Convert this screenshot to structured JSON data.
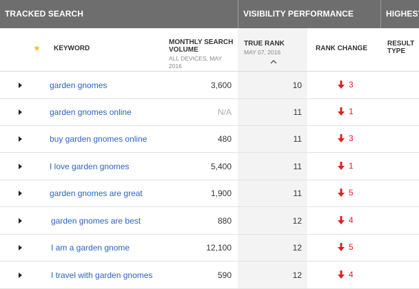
{
  "sections": {
    "tracked_search": "TRACKED SEARCH",
    "visibility_performance": "VISIBILITY PERFORMANCE",
    "highest": "HIGHEST"
  },
  "columns": {
    "keyword": "KEYWORD",
    "monthly_search_volume": "MONTHLY SEARCH VOLUME",
    "monthly_search_volume_sub": "ALL DEVICES, MAY 2016",
    "true_rank": "TRUE RANK",
    "true_rank_sub": "MAY 07, 2016",
    "rank_change": "RANK CHANGE",
    "result_type": "RESULT TYPE"
  },
  "icons": {
    "star": "star-icon",
    "sort": "chevron-up-icon",
    "expand": "caret-right-icon",
    "change": "arrow-down-icon"
  },
  "colors": {
    "header_bar": "#6e6e6e",
    "keyword_link": "#2c63c0",
    "rank_down": "#d9231f",
    "star": "#f0c020",
    "sorted_column": "#f3f3f3"
  },
  "rows": [
    {
      "keyword": "garden gnomes",
      "volume": "3,600",
      "rank": "10",
      "change": "3"
    },
    {
      "keyword": "garden gnomes online",
      "volume": "N/A",
      "rank": "11",
      "change": "1"
    },
    {
      "keyword": "buy garden gnomes online",
      "volume": "480",
      "rank": "11",
      "change": "3"
    },
    {
      "keyword": "I love garden gnomes",
      "volume": "5,400",
      "rank": "11",
      "change": "1"
    },
    {
      "keyword": "garden gnomes are great",
      "volume": "1,900",
      "rank": "11",
      "change": "5"
    },
    {
      "keyword": "garden gnomes are best",
      "volume": "880",
      "rank": "12",
      "change": "4"
    },
    {
      "keyword": "I am a garden gnome",
      "volume": "12,100",
      "rank": "12",
      "change": "5"
    },
    {
      "keyword": "I travel with garden gnomes",
      "volume": "590",
      "rank": "12",
      "change": "4"
    }
  ]
}
